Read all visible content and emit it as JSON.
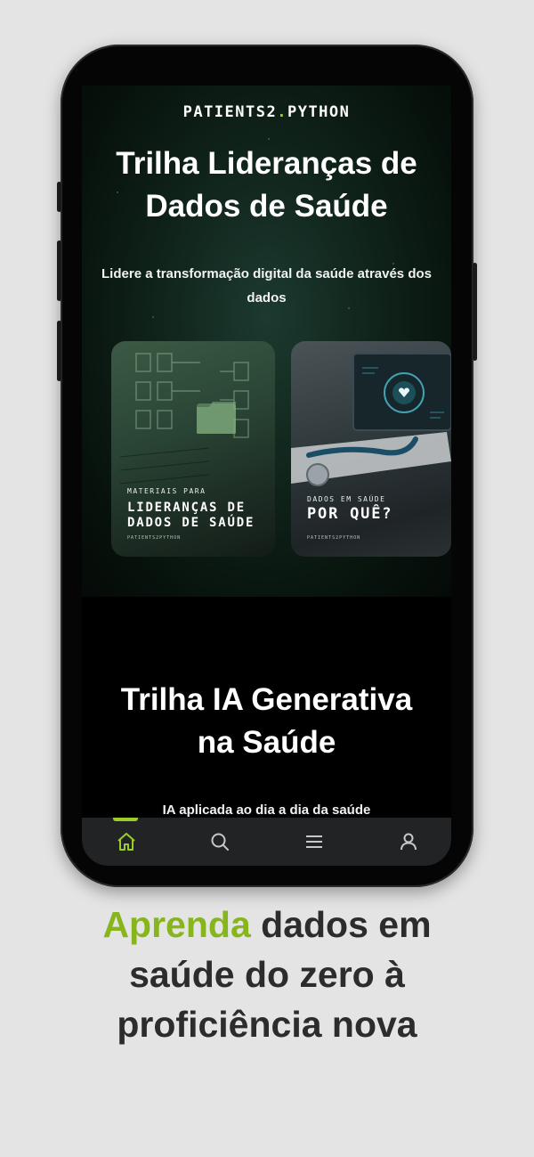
{
  "app": {
    "logo_main": "PATIENTS2",
    "logo_dot": ".",
    "logo_end": "PYTHON"
  },
  "track1": {
    "title_line1": "Trilha Lideranças de",
    "title_line2": "Dados de Saúde",
    "subtitle_line1": "Lidere a transformação digital da saúde através dos",
    "subtitle_line2": "dados",
    "cards": [
      {
        "kicker": "MATERIAIS PARA",
        "title_line1": "LIDERANÇAS DE",
        "title_line2": "DADOS DE SAÚDE",
        "footer": "PATIENTS2PYTHON"
      },
      {
        "kicker": "DADOS EM SAÚDE",
        "title_line1": "POR QUÊ?",
        "title_line2": "",
        "footer": "PATIENTS2PYTHON"
      }
    ]
  },
  "track2": {
    "title_line1": "Trilha IA Generativa",
    "title_line2": "na Saúde",
    "subtitle": "IA aplicada ao dia a dia da saúde"
  },
  "nav": {
    "items": [
      {
        "icon": "home-icon",
        "active": true
      },
      {
        "icon": "search-icon",
        "active": false
      },
      {
        "icon": "menu-icon",
        "active": false
      },
      {
        "icon": "profile-icon",
        "active": false
      }
    ],
    "accent": "#9ccc2a"
  },
  "caption": {
    "highlight": "Aprenda",
    "rest_line1": " dados em",
    "line2": "saúde do zero à",
    "line3": "proficiência nova"
  },
  "colors": {
    "brand_accent": "#9ccc2a",
    "caption_accent": "#86b51c",
    "background": "#e4e4e4"
  }
}
